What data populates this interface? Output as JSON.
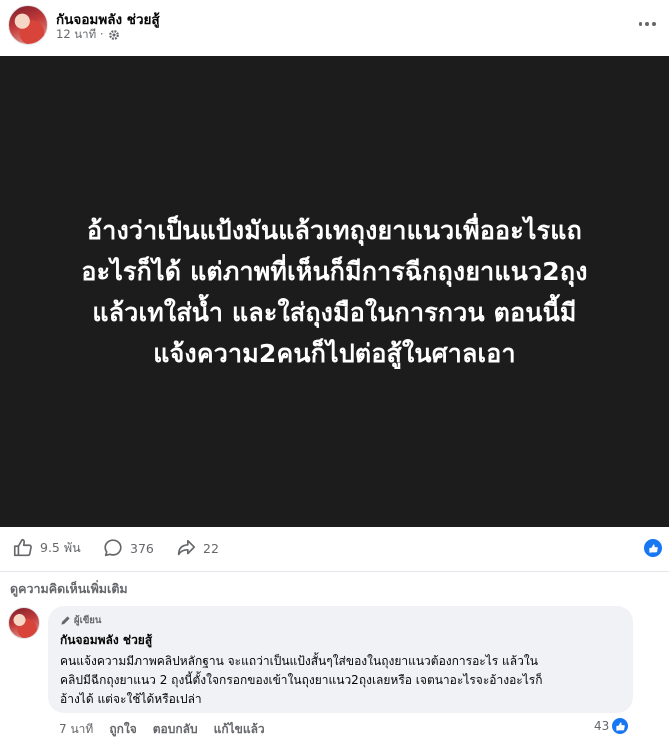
{
  "post": {
    "author": "กันจอมพลัง ช่วยสู้",
    "time": "12 นาที ·",
    "image_text": "อ้างว่าเป็นแป้งมันแล้วเทถุงยาแนวเพื่ออะไรแถ\nอะไรก็ได้ แต่ภาพที่เห็นก็มีการฉีกถุงยาแนว2ถุง\nแล้วเทใส่น้ำ และใส่ถุงมือในการกวน ตอนนี้มี\nแจ้งความ2คนก็ไปต่อสู้ในศาลเอา"
  },
  "actions": {
    "likes": "9.5 พัน",
    "comments": "376",
    "shares": "22"
  },
  "more_comments_label": "ดูความคิดเห็นเพิ่มเติม",
  "comment": {
    "badge": "ผู้เขียน",
    "author": "กันจอมพลัง ช่วยสู้",
    "text": "คนแจ้งความมีภาพคลิปหลักฐาน จะแถว่าเป็นแป้งสั้นๆใส่ของในถุงยาแนวต้องการอะไร แล้วใน\nคลิปมีฉีกถุงยาแนว 2 ถุงนี้ตั้งใจกรอกของเข้าในถุงยาแนว2ถุงเลยหรือ เจตนาอะไรจะอ้างอะไรก็\nอ้างได้ แต่จะใช้ได้หรือเปล่า",
    "time": "7 นาที",
    "like_label": "ถูกใจ",
    "reply_label": "ตอบกลับ",
    "edited_label": "แก้ไขแล้ว",
    "reaction_count": "43"
  },
  "colors": {
    "accent": "#1877f2",
    "muted_text": "#65676b",
    "image_bg": "#1c1c1c",
    "bubble_bg": "#f0f2f5"
  },
  "icons": [
    "more-icon",
    "gear-icon",
    "like-icon",
    "comment-icon",
    "share-icon",
    "thumbs-up-reaction-icon",
    "pencil-icon"
  ]
}
